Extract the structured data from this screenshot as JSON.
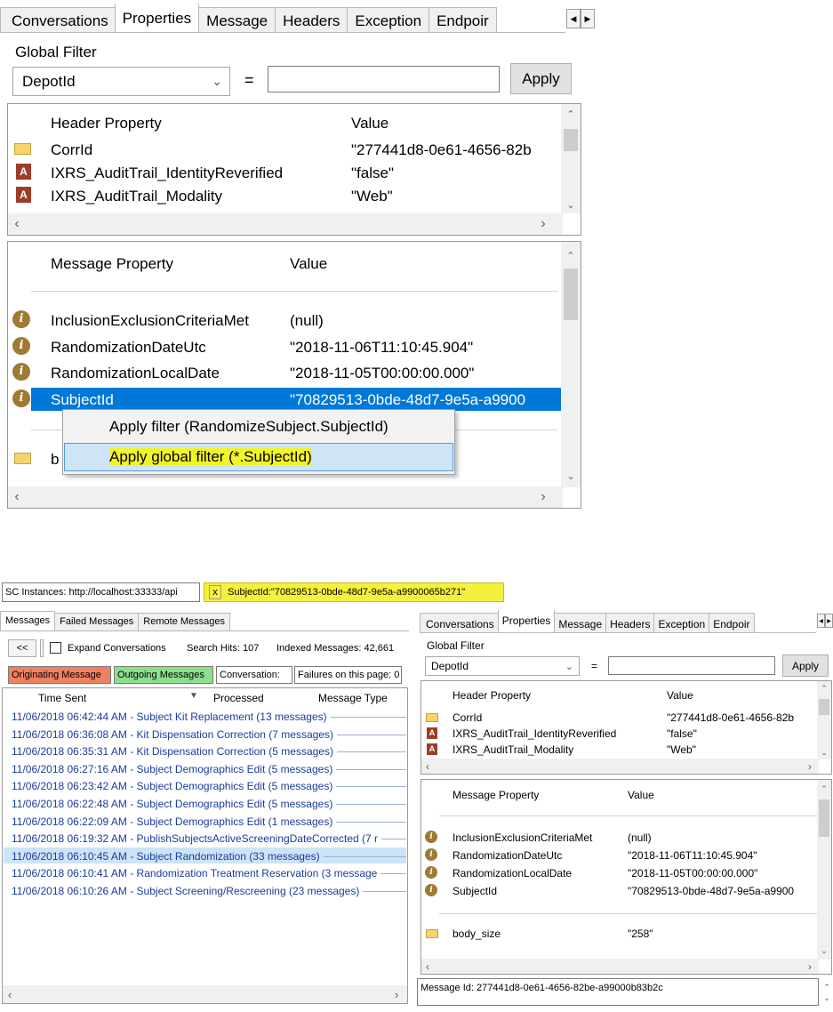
{
  "top": {
    "tabs": [
      "Conversations",
      "Properties",
      "Message",
      "Headers",
      "Exception",
      "Endpoir"
    ],
    "selected_tab": "Properties",
    "global_filter_label": "Global Filter",
    "filter_field": "DepotId",
    "equals": "=",
    "filter_value": "",
    "apply_label": "Apply",
    "header_grid": {
      "columns": [
        "Header Property",
        "Value"
      ],
      "rows": [
        {
          "icon": "envelope-icon",
          "name": "CorrId",
          "value": "\"277441d8-0e61-4656-82b"
        },
        {
          "icon": "attribute-icon",
          "name": "IXRS_AuditTrail_IdentityReverified",
          "value": "\"false\""
        },
        {
          "icon": "attribute-icon",
          "name": "IXRS_AuditTrail_Modality",
          "value": "\"Web\""
        }
      ]
    },
    "message_grid": {
      "columns": [
        "Message Property",
        "Value"
      ],
      "rows": [
        {
          "icon": "info-icon",
          "name": "InclusionExclusionCriteriaMet",
          "value": "(null)"
        },
        {
          "icon": "info-icon",
          "name": "RandomizationDateUtc",
          "value": "\"2018-11-06T11:10:45.904\""
        },
        {
          "icon": "info-icon",
          "name": "RandomizationLocalDate",
          "value": "\"2018-11-05T00:00:00.000\""
        },
        {
          "icon": "info-icon",
          "name": "SubjectId",
          "value": "\"70829513-0bde-48d7-9e5a-a9900"
        }
      ],
      "partial_row": {
        "icon": "envelope-icon",
        "name": "b"
      }
    },
    "context_menu": [
      "Apply filter (RandomizeSubject.SubjectId)",
      "Apply global filter (*.SubjectId)"
    ]
  },
  "bottom": {
    "instances_label": "SC Instances: http://localhost:33333/api",
    "filter_chip_x": "x",
    "filter_chip_text": "SubjectId:\"70829513-0bde-48d7-9e5a-a9900065b271\"",
    "left_tabs": [
      "Messages",
      "Failed Messages",
      "Remote Messages"
    ],
    "collapse_button": "<<",
    "expand_label": "Expand Conversations",
    "search_hits": "Search Hits: 107",
    "indexed": "Indexed Messages: 42,661",
    "legend": {
      "originating": "Originating Message",
      "outgoing": "Outgoing Messages",
      "conversation": "Conversation:",
      "failures": "Failures on this page: 0"
    },
    "colors": {
      "originating": "#f08060",
      "outgoing": "#8ce08c",
      "chip": "#f5f03c",
      "selection": "#0078d7"
    },
    "list_columns": [
      "Time Sent",
      "Processed",
      "Message Type"
    ],
    "list_rows": [
      "11/06/2018 06:42:44 AM - Subject Kit Replacement (13 messages)",
      "11/06/2018 06:36:08 AM - Kit Dispensation Correction (7 messages)",
      "11/06/2018 06:35:31 AM - Kit Dispensation Correction (5 messages)",
      "11/06/2018 06:27:16 AM - Subject Demographics Edit (5 messages)",
      "11/06/2018 06:23:42 AM - Subject Demographics Edit (5 messages)",
      "11/06/2018 06:22:48 AM - Subject Demographics Edit (5 messages)",
      "11/06/2018 06:22:09 AM - Subject Demographics Edit (1 messages)",
      "11/06/2018 06:19:32 AM - PublishSubjectsActiveScreeningDateCorrected (7 r",
      "11/06/2018 06:10:45 AM - Subject Randomization (33 messages)",
      "11/06/2018 06:10:41 AM - Randomization Treatment Reservation (3 message",
      "11/06/2018 06:10:26 AM - Subject Screening/Rescreening (23 messages)"
    ],
    "selected_row": 8,
    "right": {
      "tabs": [
        "Conversations",
        "Properties",
        "Message",
        "Headers",
        "Exception",
        "Endpoir"
      ],
      "global_filter_label": "Global Filter",
      "filter_field": "DepotId",
      "equals": "=",
      "apply_label": "Apply",
      "header_columns": [
        "Header Property",
        "Value"
      ],
      "header_rows": [
        {
          "name": "CorrId",
          "value": "\"277441d8-0e61-4656-82b"
        },
        {
          "name": "IXRS_AuditTrail_IdentityReverified",
          "value": "\"false\""
        },
        {
          "name": "IXRS_AuditTrail_Modality",
          "value": "\"Web\""
        }
      ],
      "message_columns": [
        "Message Property",
        "Value"
      ],
      "message_rows": [
        {
          "name": "InclusionExclusionCriteriaMet",
          "value": "(null)"
        },
        {
          "name": "RandomizationDateUtc",
          "value": "\"2018-11-06T11:10:45.904\""
        },
        {
          "name": "RandomizationLocalDate",
          "value": "\"2018-11-05T00:00:00.000\""
        },
        {
          "name": "SubjectId",
          "value": "\"70829513-0bde-48d7-9e5a-a9900"
        }
      ],
      "body_row": {
        "name": "body_size",
        "value": "\"258\""
      },
      "message_id": "Message Id: 277441d8-0e61-4656-82be-a99000b83b2c"
    }
  }
}
